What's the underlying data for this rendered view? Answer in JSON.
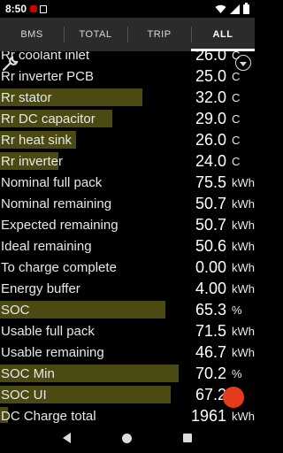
{
  "status": {
    "time": "8:50"
  },
  "tabs": [
    {
      "label": "BMS"
    },
    {
      "label": "TOTAL"
    },
    {
      "label": "TRIP"
    },
    {
      "label": "ALL"
    }
  ],
  "rows": [
    {
      "label": "Rr coolant inlet",
      "value": "26.0",
      "unit": "C",
      "level": 0
    },
    {
      "label": "Rr inverter PCB",
      "value": "25.0",
      "unit": "C",
      "level": 0
    },
    {
      "label": "Rr stator",
      "value": "32.0",
      "unit": "C",
      "level": 0.56
    },
    {
      "label": "Rr DC capacitor",
      "value": "29.0",
      "unit": "C",
      "level": 0.44
    },
    {
      "label": "Rr heat sink",
      "value": "26.0",
      "unit": "C",
      "level": 0.3
    },
    {
      "label": "Rr inverter",
      "value": "24.0",
      "unit": "C",
      "level": 0.23
    },
    {
      "label": "Nominal full pack",
      "value": "75.5",
      "unit": "kWh",
      "level": 0
    },
    {
      "label": "Nominal remaining",
      "value": "50.7",
      "unit": "kWh",
      "level": 0
    },
    {
      "label": "Expected remaining",
      "value": "50.7",
      "unit": "kWh",
      "level": 0
    },
    {
      "label": "Ideal remaining",
      "value": "50.6",
      "unit": "kWh",
      "level": 0
    },
    {
      "label": "To charge complete",
      "value": "0.00",
      "unit": "kWh",
      "level": 0
    },
    {
      "label": "Energy buffer",
      "value": "4.00",
      "unit": "kWh",
      "level": 0
    },
    {
      "label": "SOC",
      "value": "65.3",
      "unit": "%",
      "level": 0.65
    },
    {
      "label": "Usable full pack",
      "value": "71.5",
      "unit": "kWh",
      "level": 0
    },
    {
      "label": "Usable remaining",
      "value": "46.7",
      "unit": "kWh",
      "level": 0
    },
    {
      "label": "SOC Min",
      "value": "70.2",
      "unit": "%",
      "level": 0.7
    },
    {
      "label": "SOC UI",
      "value": "67.2",
      "unit": "%",
      "level": 0.67
    },
    {
      "label": "DC Charge total",
      "value": "1961",
      "unit": "kWh",
      "level": 0.03
    }
  ],
  "icons": {
    "wrench": "wrench-icon",
    "menu": "dropdown-menu-icon",
    "fab": "action-button"
  },
  "colors": {
    "bar": "#4a4a12",
    "fab": "#e53b1c",
    "tab_bg": "#2b2b2b"
  }
}
